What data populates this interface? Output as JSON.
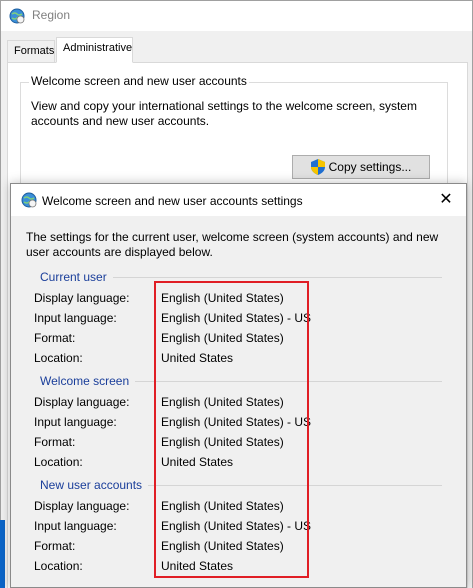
{
  "region_window": {
    "title": "Region",
    "tabs": [
      {
        "label": "Formats",
        "selected": false
      },
      {
        "label": "Administrative",
        "selected": true
      }
    ],
    "welcome_group": {
      "legend": "Welcome screen and new user accounts",
      "description": "View and copy your international settings to the welcome screen, system accounts and new user accounts.",
      "copy_button": "Copy settings..."
    }
  },
  "dialog": {
    "title": "Welcome screen and new user accounts settings",
    "close_symbol": "✕",
    "intro": "The settings for the current user, welcome screen (system accounts) and new user accounts are displayed below.",
    "sections": [
      {
        "name": "Current user",
        "rows": [
          {
            "label": "Display language:",
            "value": "English (United States)"
          },
          {
            "label": "Input language:",
            "value": "English (United States) - US"
          },
          {
            "label": "Format:",
            "value": "English (United States)"
          },
          {
            "label": "Location:",
            "value": "United States"
          }
        ]
      },
      {
        "name": "Welcome screen",
        "rows": [
          {
            "label": "Display language:",
            "value": "English (United States)"
          },
          {
            "label": "Input language:",
            "value": "English (United States) - US"
          },
          {
            "label": "Format:",
            "value": "English (United States)"
          },
          {
            "label": "Location:",
            "value": "United States"
          }
        ]
      },
      {
        "name": "New user accounts",
        "rows": [
          {
            "label": "Display language:",
            "value": "English (United States)"
          },
          {
            "label": "Input language:",
            "value": "English (United States) - US"
          },
          {
            "label": "Format:",
            "value": "English (United States)"
          },
          {
            "label": "Location:",
            "value": "United States"
          }
        ]
      }
    ]
  },
  "colors": {
    "section_header": "#1a3e9a",
    "highlight_border": "#e01e25",
    "taskbar_accent": "#0a64c8"
  },
  "icons": {
    "window_icon": "globe-clock-icon",
    "button_icon": "uac-shield-icon",
    "close_icon": "close-icon"
  }
}
